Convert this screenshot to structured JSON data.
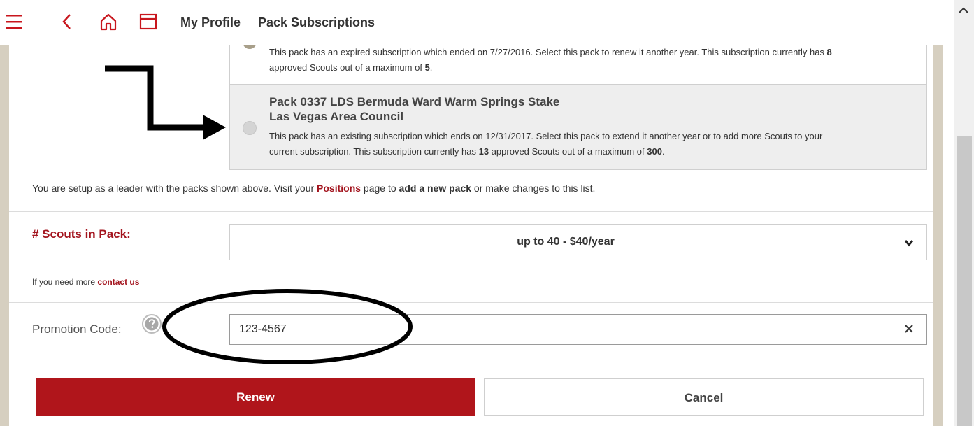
{
  "header": {
    "menu_icon": "hamburger-menu-icon",
    "back_icon": "chevron-left-icon",
    "home_icon": "home-icon",
    "window_icon": "browser-window-icon",
    "breadcrumb_1": "My Profile",
    "breadcrumb_2": "Pack Subscriptions",
    "accent_color": "#c8161d"
  },
  "packs": [
    {
      "desc_a": "This pack has an expired subscription which ended on 7/27/2016. Select this pack to renew it another year. This subscription currently has ",
      "desc_b": "8",
      "desc_c": "approved Scouts out of a maximum of ",
      "desc_d": "5",
      "desc_e": "."
    },
    {
      "title_line1": "Pack 0337 LDS Bermuda Ward Warm Springs Stake",
      "title_line2": "Las Vegas Area Council",
      "desc_a": "This pack has an existing subscription which ends on 12/31/2017. Select this pack to extend it another year or to add more Scouts to your",
      "desc_b": "current subscription. This subscription currently has ",
      "desc_c": "13",
      "desc_d": " approved Scouts out of a maximum of ",
      "desc_e": "300",
      "desc_f": "."
    }
  ],
  "leader_note": {
    "part1": "You are setup as a leader with the packs shown above. Visit your ",
    "link_positions": "Positions",
    "part2": " page to ",
    "bold_add": "add a new pack",
    "part3": " or make changes to this list."
  },
  "scouts": {
    "label": "# Scouts in Pack:",
    "selected": "up to 40 - $40/year",
    "more_prefix": "If you need more ",
    "more_link": "contact us"
  },
  "promo": {
    "label": "Promotion Code:",
    "value": "123-4567",
    "help_icon": "question-circle-icon",
    "clear_icon": "close-icon"
  },
  "buttons": {
    "renew": "Renew",
    "cancel": "Cancel",
    "renew_color": "#b0151b"
  }
}
